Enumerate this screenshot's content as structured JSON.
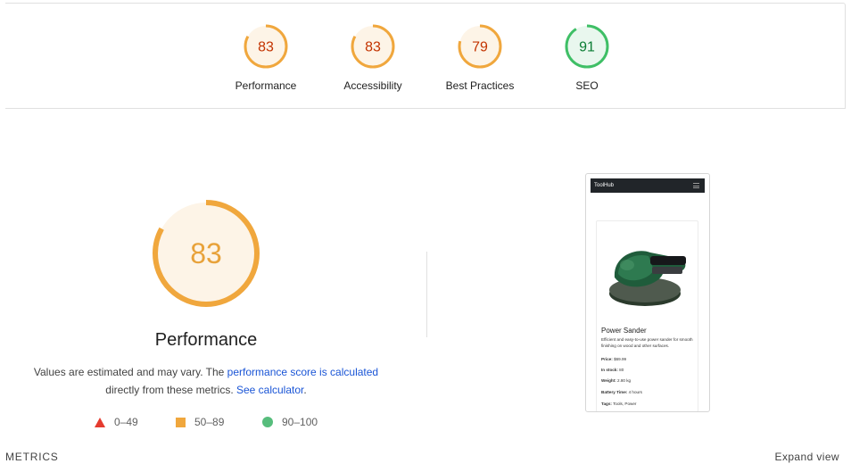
{
  "summary": {
    "gauges": [
      {
        "label": "Performance",
        "score": 83,
        "color": "#f0a73d",
        "text_color": "#c33300",
        "fill": "#fdf4e7"
      },
      {
        "label": "Accessibility",
        "score": 83,
        "color": "#f0a73d",
        "text_color": "#c33300",
        "fill": "#fdf4e7"
      },
      {
        "label": "Best Practices",
        "score": 79,
        "color": "#f0a73d",
        "text_color": "#c33300",
        "fill": "#fdf4e7"
      },
      {
        "label": "SEO",
        "score": 91,
        "color": "#3fbf66",
        "text_color": "#0b7d34",
        "fill": "#e9f7ee"
      }
    ]
  },
  "performance": {
    "score": 83,
    "title": "Performance",
    "color": "#f0a73d",
    "text_color": "#e8a23a",
    "fill": "#fdf4e7",
    "desc_prefix": "Values are estimated and may vary. The ",
    "desc_link": "performance score is calculated",
    "desc_middle": "directly from these metrics. ",
    "calc_link": "See calculator",
    "desc_suffix": "."
  },
  "legend": [
    {
      "icon": "triangle-icon",
      "label": "0–49",
      "color": "#e53b2f"
    },
    {
      "icon": "square-icon",
      "label": "50–89",
      "color": "#f0a73d"
    },
    {
      "icon": "circle-icon",
      "label": "90–100",
      "color": "#1fa750"
    }
  ],
  "screenshot": {
    "brand": "ToolHub",
    "product_title": "Power Sander",
    "product_desc": "Efficient and easy-to-use power sander for smooth finishing on wood and other surfaces.",
    "price_label": "Price:",
    "price_value": "$69.99",
    "stock_label": "In stock:",
    "stock_value": "80",
    "weight_label": "Weight:",
    "weight_value": "2.80 kg",
    "battery_label": "Battery Time:",
    "battery_value": "4 hours",
    "tags_label": "Tags:",
    "tags_value": "Tools, Power"
  },
  "footer": {
    "metrics_label": "METRICS",
    "expand_label": "Expand view"
  }
}
